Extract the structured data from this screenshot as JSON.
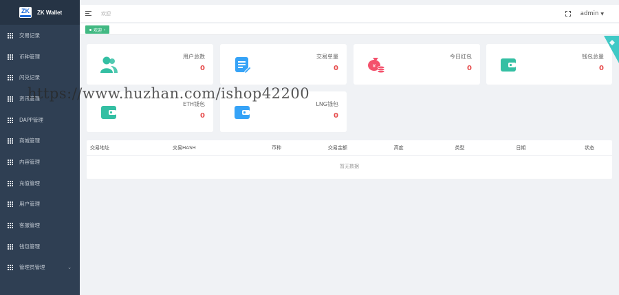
{
  "brand": {
    "logo_text": "ZK",
    "title": "ZK Wallet"
  },
  "sidebar": {
    "items": [
      {
        "label": "交易记录"
      },
      {
        "label": "币种管理"
      },
      {
        "label": "闪兑记录"
      },
      {
        "label": "资讯管理"
      },
      {
        "label": "DAPP管理"
      },
      {
        "label": "商城管理"
      },
      {
        "label": "内容管理"
      },
      {
        "label": "充值管理"
      },
      {
        "label": "用户管理"
      },
      {
        "label": "客服管理"
      },
      {
        "label": "钱包管理"
      },
      {
        "label": "管理员管理",
        "has_children": true
      }
    ]
  },
  "topbar": {
    "breadcrumb": "欢迎",
    "user": "admin"
  },
  "tabs": [
    {
      "label": "欢迎"
    }
  ],
  "cards": [
    {
      "label": "用户总数",
      "value": "0",
      "icon": "users-icon",
      "color": "#34bfa3"
    },
    {
      "label": "交易单量",
      "value": "0",
      "icon": "edit-document-icon",
      "color": "#36a3f7"
    },
    {
      "label": "今日红包",
      "value": "0",
      "icon": "money-bag-icon",
      "color": "#f4516c"
    },
    {
      "label": "钱包总量",
      "value": "0",
      "icon": "wallet-icon",
      "color": "#34bfa3"
    },
    {
      "label": "ETH钱包",
      "value": "0",
      "icon": "wallet-icon",
      "color": "#34bfa3"
    },
    {
      "label": "LNG钱包",
      "value": "0",
      "icon": "wallet-icon",
      "color": "#36a3f7"
    }
  ],
  "table": {
    "columns": [
      "交易地址",
      "交易HASH",
      "币种",
      "交易金额",
      "高度",
      "类型",
      "日期",
      "状态"
    ],
    "empty_text": "暂无数据"
  },
  "watermark": "https://www.huzhan.com/ishop42200"
}
